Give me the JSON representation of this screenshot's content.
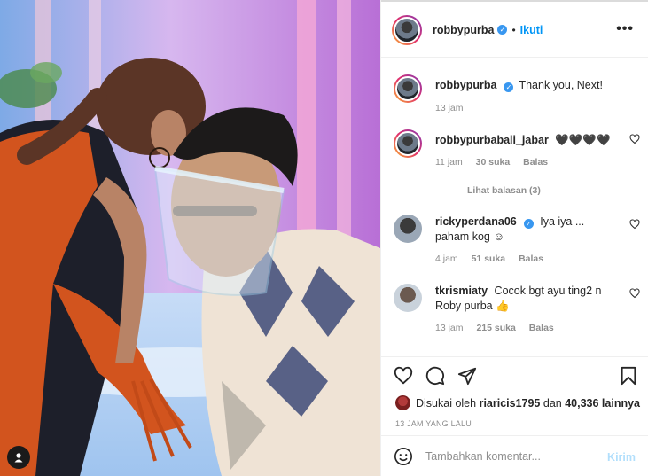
{
  "post": {
    "username": "robbypurba",
    "verified_mark": "✓",
    "separator": "•",
    "follow_label": "Ikuti",
    "more_label": "•••"
  },
  "comments": [
    {
      "username": "robbypurba",
      "verified": true,
      "text": "Thank you, Next!",
      "time": "13 jam"
    },
    {
      "username": "robbypurbabali_jabar",
      "verified": false,
      "text": "🖤🖤🖤🖤",
      "time": "11 jam",
      "likes": "30 suka",
      "reply_label": "Balas",
      "view_replies": "Lihat balasan (3)"
    },
    {
      "username": "rickyperdana06",
      "verified": true,
      "text": "Iya iya ... paham kog ☺",
      "time": "4 jam",
      "likes": "51 suka",
      "reply_label": "Balas"
    },
    {
      "username": "tkrismiaty",
      "verified": false,
      "text": "Cocok bgt ayu ting2 n Roby purba 👍",
      "time": "13 jam",
      "likes": "215 suka",
      "reply_label": "Balas"
    }
  ],
  "actions": {
    "liked_by_prefix": "Disukai oleh",
    "liked_by_user": "riaricis1795",
    "liked_by_middle": "dan",
    "liked_by_count": "40,336 lainnya",
    "posted_time": "13 JAM YANG LALU"
  },
  "add_comment": {
    "placeholder": "Tambahkan komentar...",
    "post_label": "Kirim"
  },
  "icons": [
    "heart-icon",
    "comment-icon",
    "share-icon",
    "bookmark-icon",
    "emoji-icon",
    "user-tag-icon",
    "more-icon",
    "verified-icon"
  ],
  "colors": {
    "accent": "#0095f6",
    "verified": "#3897f0",
    "muted": "#8e8e8e",
    "post_disabled": "#b2dffc"
  }
}
